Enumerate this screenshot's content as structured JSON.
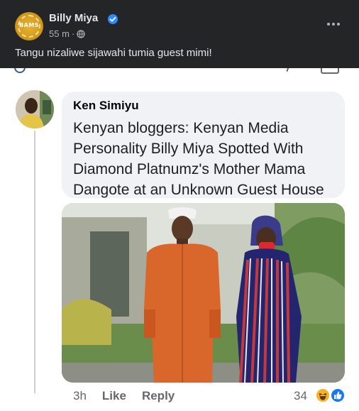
{
  "post": {
    "author": "Billy Miya",
    "time": "55 m",
    "separator": "·",
    "caption": "Tangu nizaliwe sijawahi tumia guest mimi!",
    "avatar_text": "BAMS"
  },
  "shared_comment": {
    "name": "Ken Simiyu",
    "text": "Kenyan bloggers: Kenyan Media Personality Billy Miya Spotted With Diamond Platnumz's Mother Mama Dangote at an Unknown Guest House",
    "time": "3h",
    "like_label": "Like",
    "reply_label": "Reply",
    "reaction_count": "34"
  },
  "colors": {
    "dark_bg": "#242526",
    "primary_text": "#e4e6eb",
    "secondary_text": "#b0b3b8",
    "verified_blue": "#2d88ff",
    "bubble_bg": "#f0f2f5",
    "action_grey": "#65676b"
  },
  "icons": [
    "verified-badge-icon",
    "globe-icon",
    "more-options-icon",
    "haha-reaction-icon",
    "like-reaction-icon"
  ]
}
